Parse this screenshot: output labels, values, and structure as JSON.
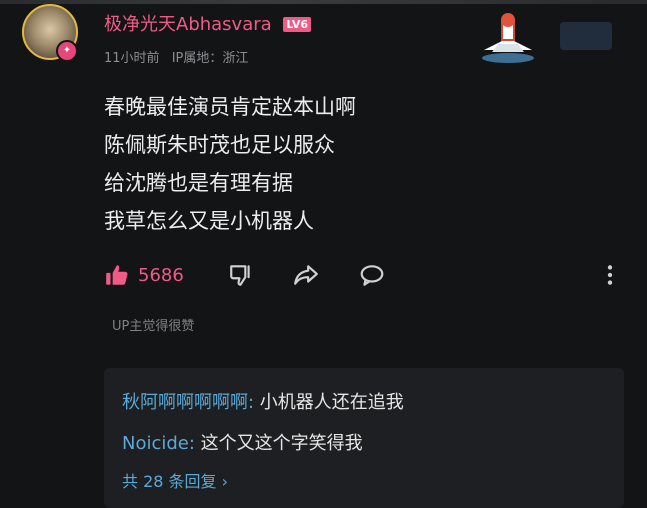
{
  "comment": {
    "username": "极净光天Abhasvara",
    "level": "LV6",
    "time": "11小时前",
    "ip_location": "IP属地：浙江",
    "lines": [
      "春晚最佳演员肯定赵本山啊",
      "陈佩斯朱时茂也足以服众",
      "给沈腾也是有理有据",
      "我草怎么又是小机器人"
    ],
    "like_count": "5686",
    "up_liked": "UP主觉得很赞"
  },
  "replies": [
    {
      "name": "秋阿啊啊啊啊啊:",
      "text": " 小机器人还在追我"
    },
    {
      "name": "Noicide:",
      "text": " 这个又这个字笑得我"
    }
  ],
  "more_replies": "共 28 条回复 ›",
  "icons": {
    "like": "thumbs-up-icon",
    "dislike": "thumbs-down-icon",
    "share": "share-icon",
    "reply": "comment-icon",
    "more": "more-vertical-icon"
  },
  "colors": {
    "accent": "#f05a86",
    "link": "#5aa9d6",
    "background": "#131416"
  }
}
